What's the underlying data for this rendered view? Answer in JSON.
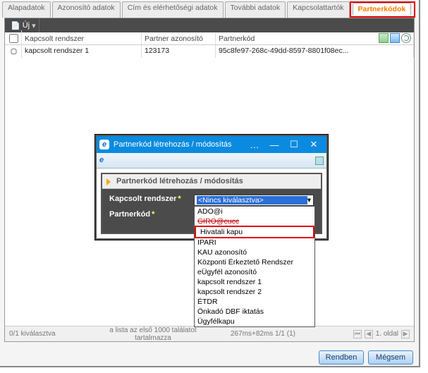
{
  "tabs": {
    "items": [
      "Alapadatok",
      "Azonosító adatok",
      "Cím és elérhetőségi adatok",
      "További adatok",
      "Kapcsolattartók",
      "Partnerkódok"
    ],
    "activeIndex": 5
  },
  "toolbar": {
    "newLabel": "Új"
  },
  "table": {
    "headers": {
      "system": "Kapcsolt rendszer",
      "partnerId": "Partner azonosító",
      "partnerCode": "Partnerkód"
    },
    "rows": [
      {
        "system": "kapcsolt rendszer 1",
        "partnerId": "123173",
        "partnerCode": "95c8fe97-268c-49dd-8597-8801f08ec..."
      }
    ]
  },
  "statusbar": {
    "selection": "0/1 kiválasztva",
    "listInfo": "a lista az első 1000 találatot tartalmazza",
    "timing": "267ms+82ms 1/1 (1)",
    "page": "1. oldal"
  },
  "buttons": {
    "ok": "Rendben",
    "cancel": "Mégsem"
  },
  "modal": {
    "title": "Partnerkód létrehozás / módosítás",
    "innerTitle": "Partnerkód létrehozás / módosítás",
    "fields": {
      "systemLabel": "Kapcsolt rendszer",
      "codeLabel": "Partnerkód",
      "required": "*",
      "selected": "<Nincs kiválasztva>"
    },
    "options": [
      {
        "label": "ADO@i"
      },
      {
        "label": "GIRO@cucc",
        "strike": true
      },
      {
        "label": "Hivatali kapu",
        "highlight": true
      },
      {
        "label": "IPARI"
      },
      {
        "label": "KAU azonosító"
      },
      {
        "label": "Központi Érkeztető Rendszer"
      },
      {
        "label": "eÜgyfél azonosító"
      },
      {
        "label": "kapcsolt rendszer 1"
      },
      {
        "label": "kapcsolt rendszer 2"
      },
      {
        "label": "ÉTDR"
      },
      {
        "label": "Önkadó DBF iktatás"
      },
      {
        "label": "Ügyfélkapu"
      }
    ]
  }
}
